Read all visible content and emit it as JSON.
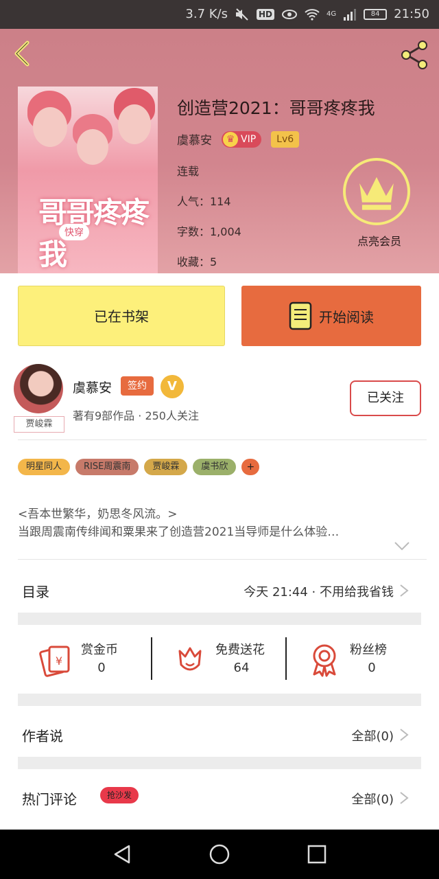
{
  "status_bar": {
    "speed": "3.7 K/s",
    "hd": "HD",
    "network": "4G",
    "battery": "84",
    "time": "21:50"
  },
  "book": {
    "title": "创造营2021：哥哥疼疼我",
    "author": "虞慕安",
    "vip_label": "VIP",
    "level_label": "Lv6",
    "status": "连载",
    "popularity": "人气：114",
    "word_count": "字数：1,004",
    "favorites": "收藏：5",
    "cover": {
      "title": "哥哥疼疼我",
      "subtitle": "快穿"
    }
  },
  "member": {
    "label": "点亮会员"
  },
  "actions": {
    "shelf_label": "已在书架",
    "read_label": "开始阅读"
  },
  "author_card": {
    "name": "虞慕安",
    "sign_label": "签约",
    "v_label": "V",
    "stats": "著有9部作品 · 250人关注",
    "avatar_tag": "贾峻霖",
    "follow_label": "已关注"
  },
  "tags": [
    "明星同人",
    "RISE周震南",
    "贾峻霖",
    "虞书欣"
  ],
  "tag_more": "+",
  "intro": {
    "line1": "<吾本世繁华，奶思冬风流。>",
    "line2": "当跟周震南传绯闻和粟果来了创造营2021当导师是什么体验…"
  },
  "catalog": {
    "label": "目录",
    "update": "今天 21:44 · 不用给我省钱"
  },
  "rewards": [
    {
      "label": "赏金币",
      "value": "0",
      "icon": "red-envelope-icon"
    },
    {
      "label": "免费送花",
      "value": "64",
      "icon": "flower-icon"
    },
    {
      "label": "粉丝榜",
      "value": "0",
      "icon": "award-ribbon-icon"
    }
  ],
  "author_says": {
    "label": "作者说",
    "count": "全部(0)"
  },
  "hot_comments": {
    "label": "热门评论",
    "badge": "抢沙发",
    "count": "全部(0)"
  },
  "colors": {
    "hero_bg": "#cc8088",
    "shelf_button": "#fdf07b",
    "read_button": "#e76b3f",
    "accent_red": "#d94a4a",
    "crown_yellow": "#f6ea78"
  }
}
